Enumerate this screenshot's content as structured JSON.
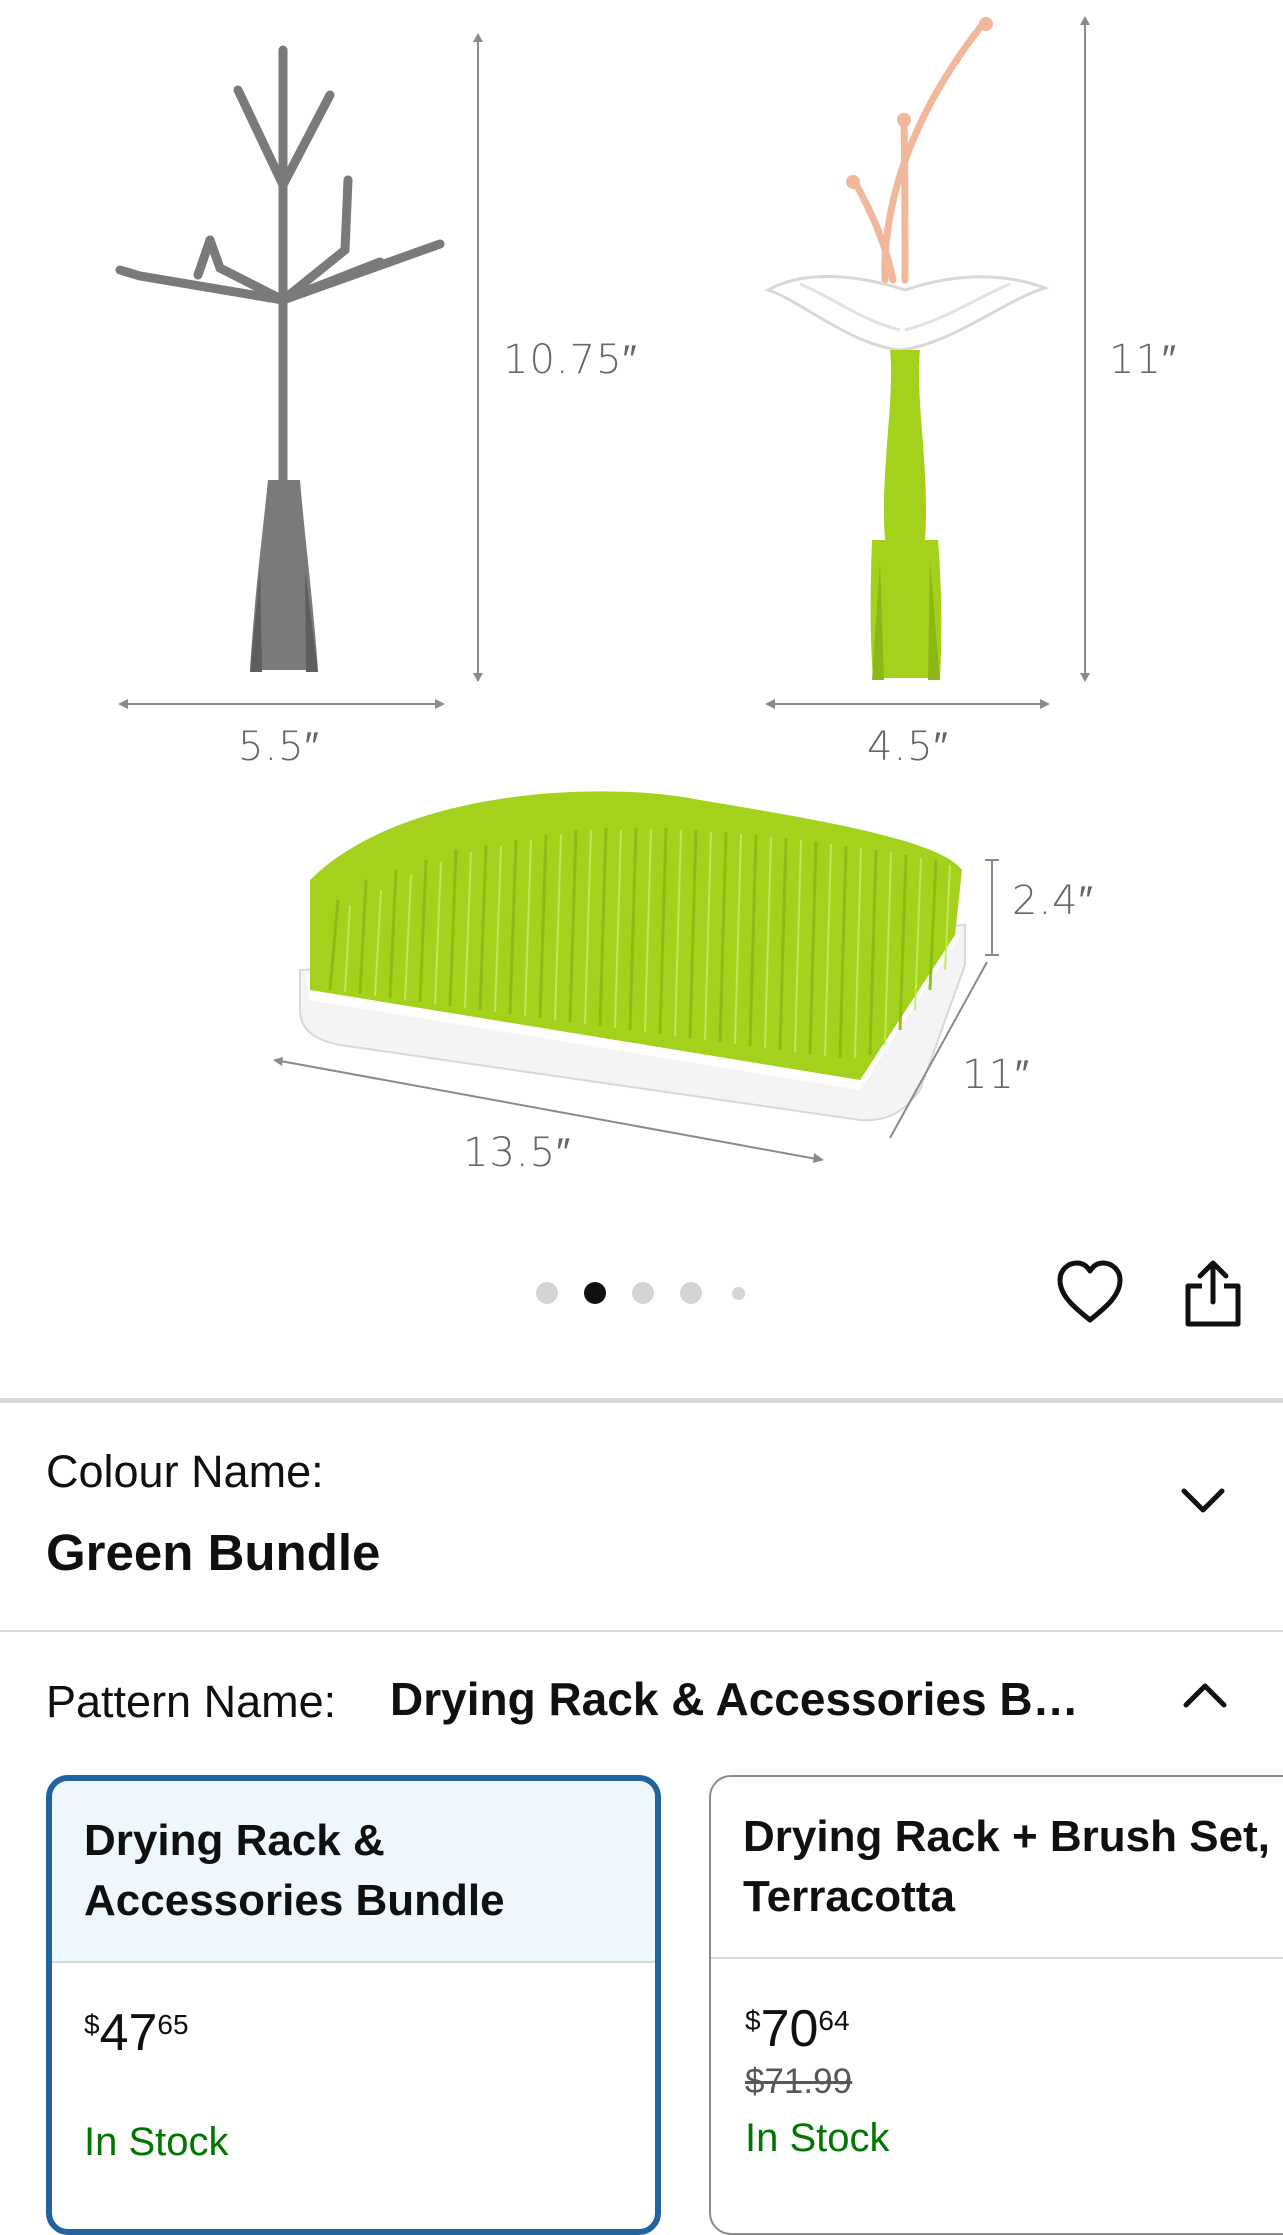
{
  "product_image": {
    "dims": {
      "twig_height": "10.75″",
      "twig_width": "5.5″",
      "stem_height": "11″",
      "stem_width": "4.5″",
      "lawn_height": "2.4″",
      "lawn_depth": "11″",
      "lawn_width": "13.5″"
    },
    "colors": {
      "grey": "#7a7a7a",
      "green": "#a4d11c",
      "peach": "#f2b89b",
      "white": "#ffffff"
    }
  },
  "carousel": {
    "count": 5,
    "active_index": 1
  },
  "actions": {
    "favorite_icon": "heart-icon",
    "share_icon": "share-icon"
  },
  "colour": {
    "label": "Colour Name:",
    "value": "Green Bundle"
  },
  "pattern": {
    "label": "Pattern Name:",
    "value": "Drying Rack & Accessories B…"
  },
  "options": [
    {
      "title": "Drying Rack & Accessories Bundle",
      "price_symbol": "$",
      "price_whole": "47",
      "price_fraction": "65",
      "was_price": "",
      "stock": "In Stock",
      "selected": true
    },
    {
      "title": "Drying Rack + Brush Set, Terracotta",
      "price_symbol": "$",
      "price_whole": "70",
      "price_fraction": "64",
      "was_price": "$71.99",
      "stock": "In Stock",
      "selected": false
    }
  ],
  "theme": {
    "accent": "#2162a1",
    "selected_bg": "#edf7fc",
    "in_stock": "#007600"
  }
}
